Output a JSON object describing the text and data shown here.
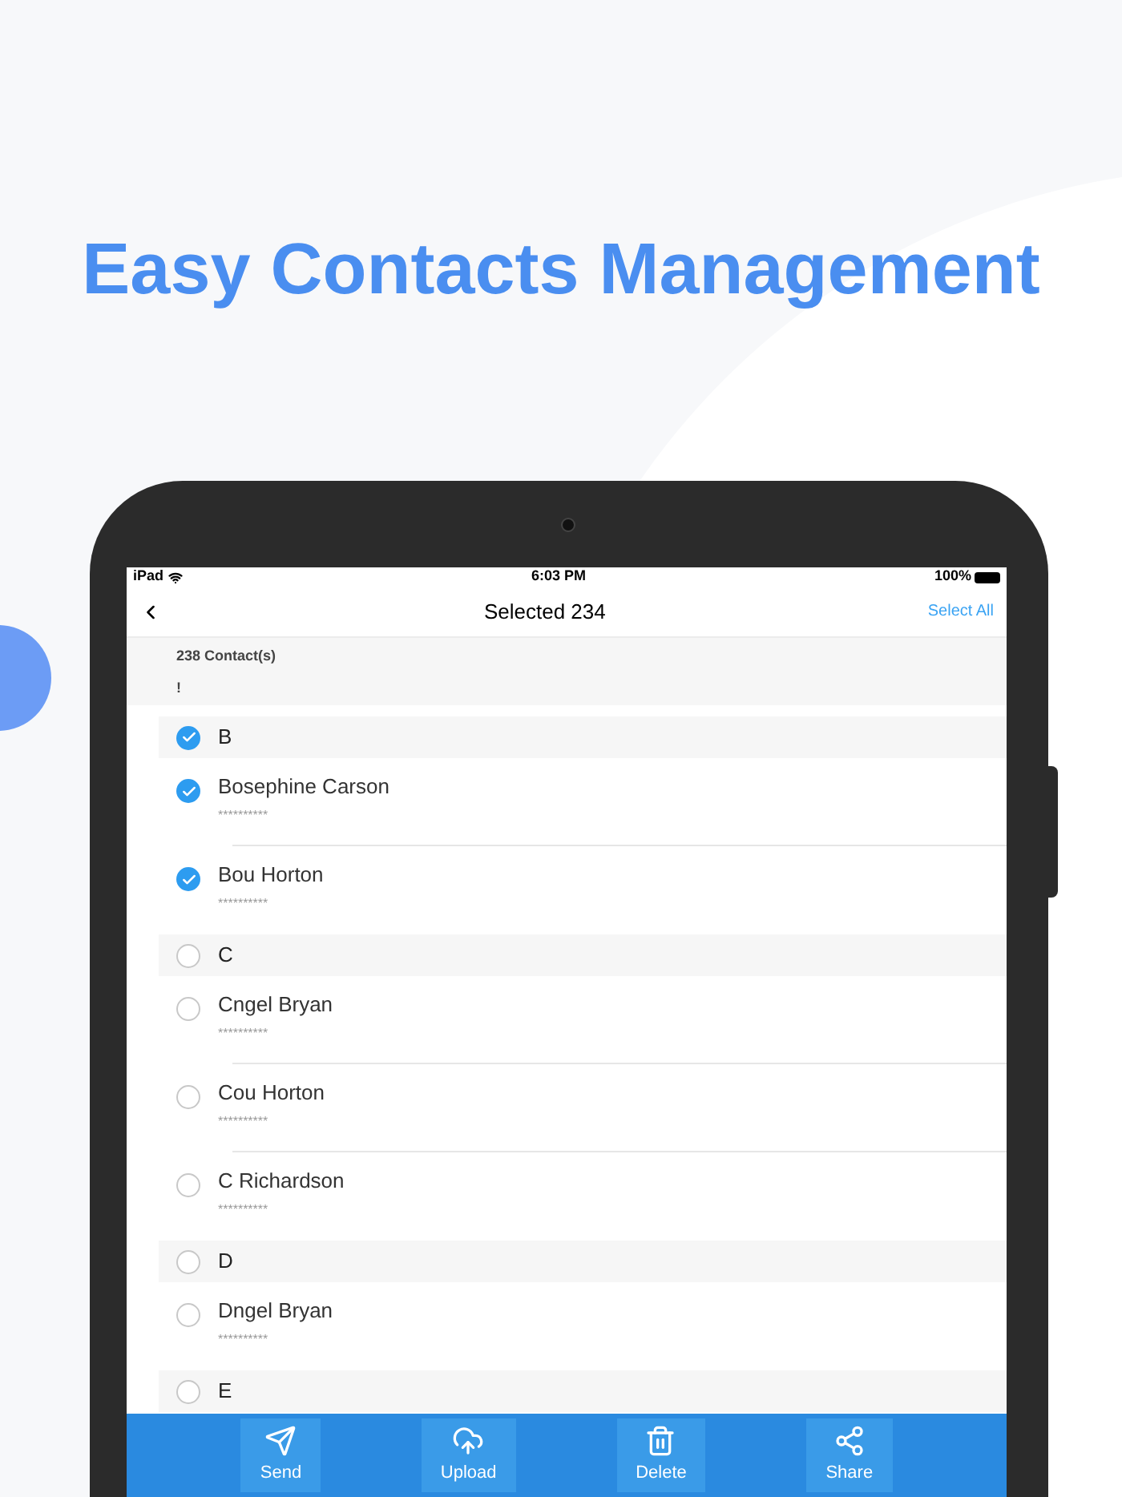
{
  "headline": "Easy Contacts Management",
  "status_bar": {
    "carrier": "iPad",
    "time": "6:03 PM",
    "battery": "100%"
  },
  "nav": {
    "title": "Selected 234",
    "action": "Select All"
  },
  "summary": {
    "count": "238 Contact(s)",
    "index": "!"
  },
  "sections": [
    {
      "letter": "B",
      "selected": true,
      "contacts": [
        {
          "name": "Bosephine Carson",
          "phone": "**********",
          "selected": true
        },
        {
          "name": "Bou Horton",
          "phone": "**********",
          "selected": true
        }
      ]
    },
    {
      "letter": "C",
      "selected": false,
      "contacts": [
        {
          "name": "Cngel Bryan",
          "phone": "**********",
          "selected": false
        },
        {
          "name": "Cou Horton",
          "phone": "**********",
          "selected": false
        },
        {
          "name": "C Richardson",
          "phone": "**********",
          "selected": false
        }
      ]
    },
    {
      "letter": "D",
      "selected": false,
      "contacts": [
        {
          "name": "Dngel Bryan",
          "phone": "**********",
          "selected": false
        }
      ]
    },
    {
      "letter": "E",
      "selected": false
    }
  ],
  "toolbar": [
    {
      "label": "Send",
      "kind": "send"
    },
    {
      "label": "Upload",
      "kind": "upload"
    },
    {
      "label": "Delete",
      "kind": "delete"
    },
    {
      "label": "Share",
      "kind": "share"
    }
  ]
}
